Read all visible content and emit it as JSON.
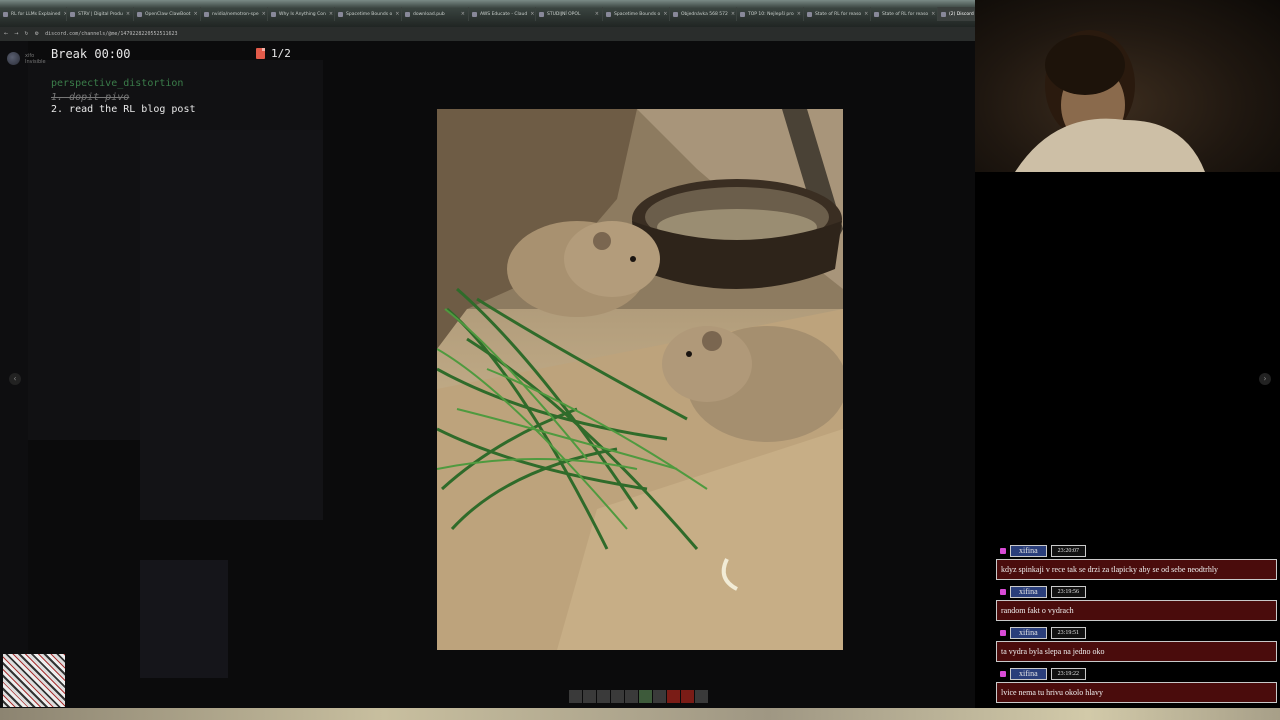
{
  "browser": {
    "tabs": [
      {
        "label": "RL for LLMs Explained"
      },
      {
        "label": "STRV | Digital Produ"
      },
      {
        "label": "OpenClaw ClawBoot"
      },
      {
        "label": "nvidia/nemotron-spe"
      },
      {
        "label": "Why Is Anything Con"
      },
      {
        "label": "Spacetime Bounds o"
      },
      {
        "label": "download.pub"
      },
      {
        "label": "AWS Educate - Claud"
      },
      {
        "label": "STUDIJNÍ OPOL"
      },
      {
        "label": "Spacetime Bounds o"
      },
      {
        "label": "Objednávka 568 572"
      },
      {
        "label": "TOP 10: Nejlepší pro"
      },
      {
        "label": "State of RL for reaso"
      },
      {
        "label": "State of RL for reaso"
      },
      {
        "label": "(2) Discord | @xifo",
        "active": true
      },
      {
        "label": "stra"
      }
    ],
    "url": "discord.com/channels/@me/1479228220552511623"
  },
  "discord": {
    "user_name": "xifo",
    "user_status": "Invisible"
  },
  "overlay": {
    "timer": "Break 00:00",
    "page_count": "1/2",
    "todo_title": "perspective_distortion",
    "todo_items": [
      {
        "text": "1. dopit pivo",
        "done": true
      },
      {
        "text": "2. read the RL blog post",
        "done": false
      }
    ]
  },
  "photo": {
    "subject": "two degus beside a pile of grass and a metal bowl"
  },
  "navigation": {
    "prev_icon": "chevron-left-icon",
    "next_icon": "chevron-right-icon"
  },
  "chat": {
    "messages": [
      {
        "user": "xifina",
        "time": "23:20:07",
        "text": "kdyz spinkaji v rece tak se drzi za tlapicky aby se od sebe neodtrhly"
      },
      {
        "user": "xifina",
        "time": "23:19:56",
        "text": "random fakt o vydrach"
      },
      {
        "user": "xifina",
        "time": "23:19:51",
        "text": "ta vydra byla slepa na jedno oko"
      },
      {
        "user": "xifina",
        "time": "23:19:22",
        "text": "lvice nema tu hrivu okolo hlavy"
      }
    ]
  },
  "colors": {
    "chat_user_bg": "#2a3e7a",
    "chat_text_bg": "#4a0c0c",
    "todo_title": "#3b7d4a",
    "badge": "#d94ad6"
  }
}
